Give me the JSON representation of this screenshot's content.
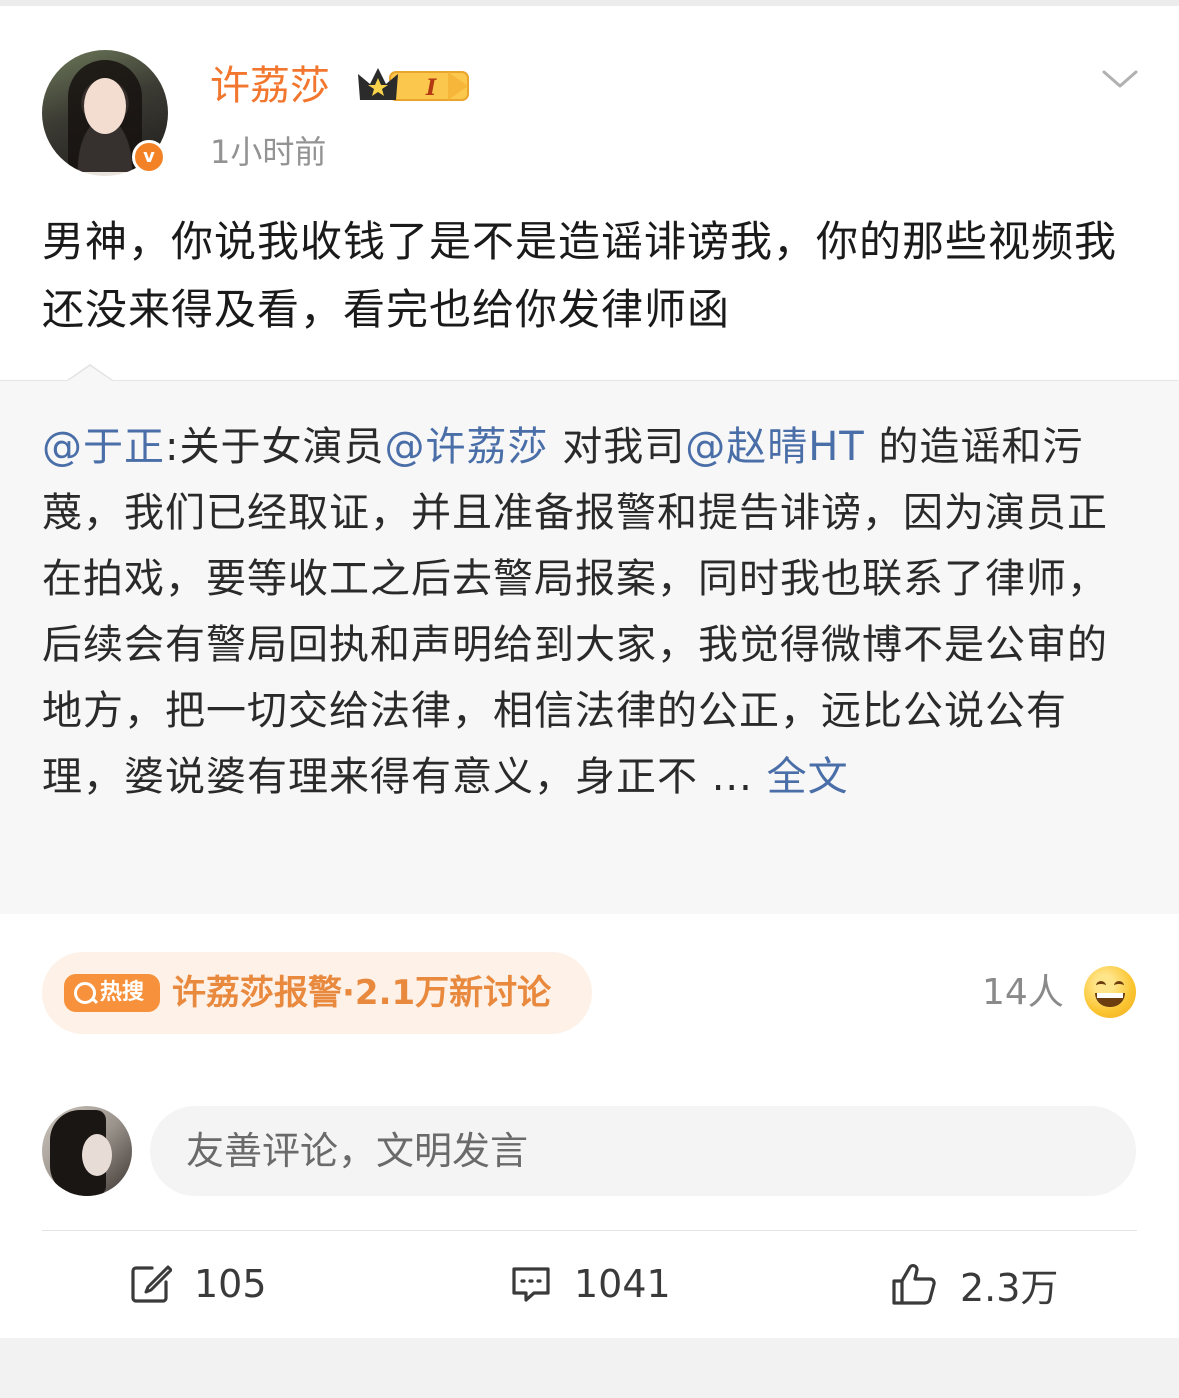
{
  "post": {
    "username": "许荔莎",
    "vip_level": "I",
    "time": "1小时前",
    "text": "男神，你说我收钱了是不是造谣诽谤我，你的那些视频我还没来得及看，看完也给你发律师函"
  },
  "repost": {
    "author": "@于正",
    "colon": ":",
    "text_1": "关于女演员",
    "mention_1": "@许荔莎",
    "text_2": " 对我司",
    "mention_2": "@赵晴HT",
    "text_3": " 的造谣和污蔑，我们已经取证，并且准备报警和提告诽谤，因为演员正在拍戏，要等收工之后去警局报案，同时我也联系了律师，后续会有警局回执和声明给到大家，我觉得微博不是公审的地方，把一切交给法律，相信法律的公正，远比公说公有理，婆说婆有理来得有意义，身正不 ... ",
    "full_text_link": "全文"
  },
  "hot_search": {
    "badge": "热搜",
    "text": "许荔莎报警·2.1万新讨论"
  },
  "reactions": {
    "count": "14人",
    "emoji": "grinning-sweat-emoji"
  },
  "comment_box": {
    "placeholder": "友善评论，文明发言"
  },
  "actions": {
    "reposts": "105",
    "comments": "1041",
    "likes": "2.3万"
  },
  "colors": {
    "username": "#f2762e",
    "link": "#4a6ea8",
    "hot": "#e8893e",
    "verified": "#f38125"
  }
}
